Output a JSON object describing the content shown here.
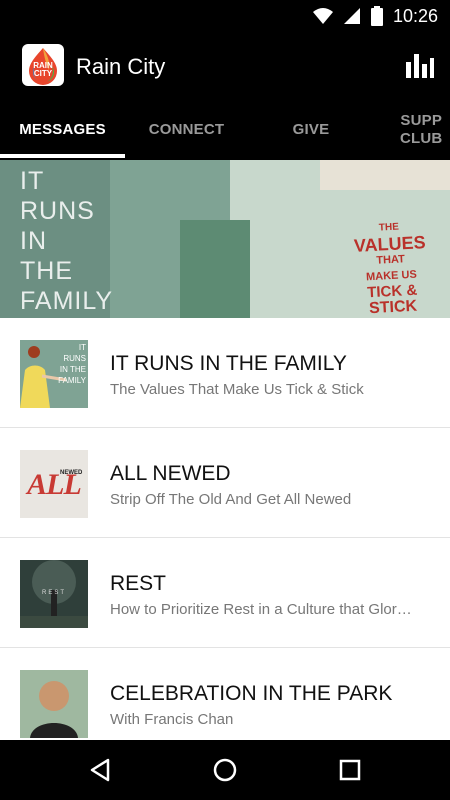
{
  "status_bar": {
    "time": "10:26",
    "icons": [
      "wifi-icon",
      "signal-icon",
      "battery-icon"
    ]
  },
  "app_bar": {
    "logo_text_1": "RAIN",
    "logo_text_2": "CITY",
    "title": "Rain City",
    "action_icon": "bar-chart-icon"
  },
  "tabs": [
    {
      "label": "MESSAGES",
      "active": true
    },
    {
      "label": "CONNECT",
      "active": false
    },
    {
      "label": "GIVE",
      "active": false
    },
    {
      "label": "SUPP\nCLUB",
      "active": false
    }
  ],
  "hero": {
    "lines": [
      "IT",
      "RUNS",
      "IN",
      "THE",
      "FAMILY"
    ],
    "can_text": [
      "THE",
      "VALUES",
      "THAT",
      "MAKE US",
      "TICK &",
      "STICK"
    ]
  },
  "messages": [
    {
      "title": "IT RUNS IN THE FAMILY",
      "subtitle": "The Values That Make Us Tick & Stick",
      "thumb_text": "IT RUNS IN THE FAMILY"
    },
    {
      "title": "ALL NEWED",
      "subtitle": "Strip Off The Old And Get All Newed",
      "thumb_text": "ALL",
      "thumb_text_small": "NEWED"
    },
    {
      "title": "REST",
      "subtitle": "How to Prioritize Rest in a Culture that Glor…",
      "thumb_text": "REST"
    },
    {
      "title": "CELEBRATION IN THE PARK",
      "subtitle": "With Francis Chan"
    }
  ],
  "nav_bar": {
    "icons": [
      "back-icon",
      "home-icon",
      "recents-icon"
    ]
  },
  "colors": {
    "bar_bg": "#000000",
    "active_tab": "#ffffff",
    "inactive_tab": "#9a9a9a",
    "title_text": "#111111",
    "subtitle_text": "#777777"
  }
}
